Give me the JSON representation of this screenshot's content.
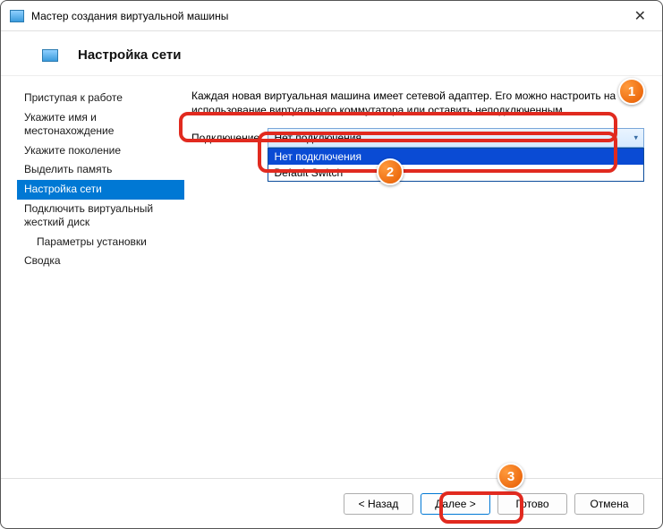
{
  "window": {
    "title": "Мастер создания виртуальной машины"
  },
  "header": {
    "title": "Настройка сети"
  },
  "sidebar": {
    "items": [
      {
        "label": "Приступая к работе",
        "active": false
      },
      {
        "label": "Укажите имя и местонахождение",
        "active": false
      },
      {
        "label": "Укажите поколение",
        "active": false
      },
      {
        "label": "Выделить память",
        "active": false
      },
      {
        "label": "Настройка сети",
        "active": true
      },
      {
        "label": "Подключить виртуальный жесткий диск",
        "active": false
      },
      {
        "label": "Параметры установки",
        "active": false,
        "sub": true
      },
      {
        "label": "Сводка",
        "active": false
      }
    ]
  },
  "main": {
    "description": "Каждая новая виртуальная машина имеет сетевой адаптер. Его можно настроить на использование виртуального коммутатора или оставить неподключенным.",
    "connection_label": "Подключение:",
    "connection_value": "Нет подключения",
    "dropdown_options": [
      {
        "label": "Нет подключения",
        "selected": true
      },
      {
        "label": "Default Switch",
        "selected": false
      }
    ]
  },
  "buttons": {
    "back": "< Назад",
    "next": "Далее >",
    "finish": "Готово",
    "cancel": "Отмена"
  },
  "annotations": {
    "b1": "1",
    "b2": "2",
    "b3": "3"
  }
}
